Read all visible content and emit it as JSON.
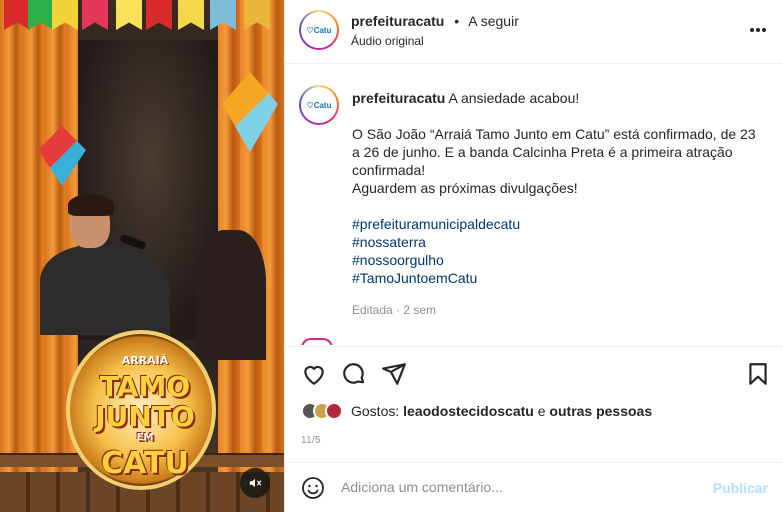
{
  "media": {
    "logo_top": "ARRAIÁ",
    "logo_line1": "TAMO",
    "logo_line2": "JUNTO",
    "logo_em": "EM",
    "logo_city": "CATU"
  },
  "header": {
    "username": "prefeituracatu",
    "separator": "•",
    "follow_label": "A seguir",
    "audio_label": "Áudio original",
    "avatar_text": "♡Catu"
  },
  "caption": {
    "username": "prefeituracatu",
    "first_line": "A ansiedade acabou!",
    "paragraph": "O São João “Arraiá Tamo Junto em Catu” está confirmado, de 23 a 26 de junho. E a banda Calcinha Preta é a primeira atração confirmada!",
    "closing": "Aguardem as próximas divulgações!",
    "hashtags": [
      "#prefeituramunicipaldecatu",
      "#nossaterra",
      "#nossoorgulho",
      "#TamoJuntoemCatu"
    ],
    "meta": "Editada · 2 sem"
  },
  "likes": {
    "prefix": "Gostos: ",
    "user": "leaodostecidoscatu",
    "middle": " e ",
    "rest": "outras pessoas"
  },
  "date": "11/5",
  "comment": {
    "placeholder": "Adiciona um comentário...",
    "publish_label": "Publicar"
  },
  "icons": {
    "like": "heart-icon",
    "comment": "comment-icon",
    "share": "share-icon",
    "save": "bookmark-icon",
    "more": "more-options-icon",
    "emoji": "emoji-icon",
    "mute": "muted-speaker-icon"
  },
  "colors": {
    "hashtag": "#00376b",
    "publish_disabled": "#b2dffc",
    "muted_text": "#8e8e8e"
  }
}
